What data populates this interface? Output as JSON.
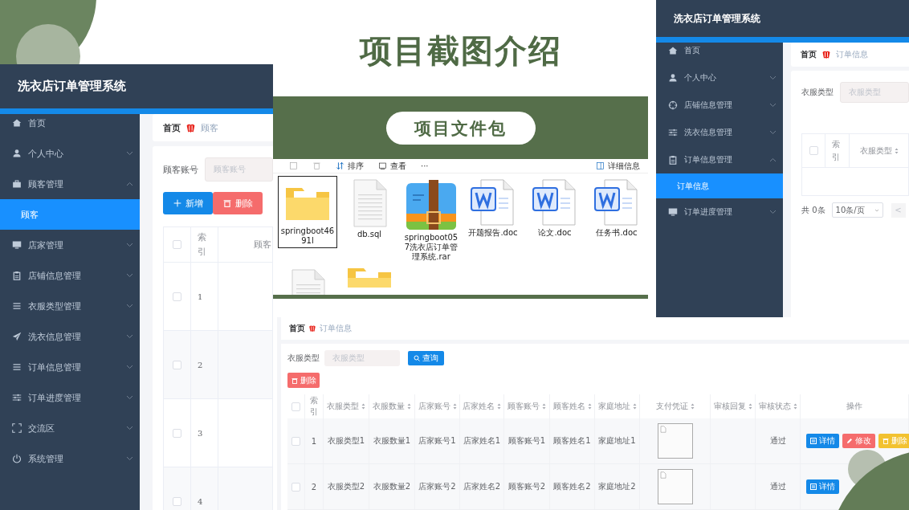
{
  "heading": "项目截图介绍",
  "customer_window": {
    "app_title": "洗衣店订单管理系统",
    "menu": [
      {
        "label": "首页"
      },
      {
        "label": "个人中心",
        "expanded": false
      },
      {
        "label": "顾客管理",
        "expanded": true,
        "children": [
          {
            "label": "顾客",
            "selected": true
          }
        ]
      },
      {
        "label": "店家管理",
        "expanded": false
      },
      {
        "label": "店铺信息管理",
        "expanded": false
      },
      {
        "label": "衣服类型管理",
        "expanded": false
      },
      {
        "label": "洗衣信息管理",
        "expanded": false
      },
      {
        "label": "订单信息管理",
        "expanded": false
      },
      {
        "label": "订单进度管理",
        "expanded": false
      },
      {
        "label": "交流区",
        "expanded": false
      },
      {
        "label": "系统管理",
        "expanded": false
      }
    ],
    "breadcrumb": [
      "首页",
      "顾客"
    ],
    "search": {
      "label": "顾客账号",
      "placeholder": "顾客账号"
    },
    "buttons": [
      {
        "kind": "add",
        "label": "新增"
      },
      {
        "kind": "delete",
        "label": "删除"
      }
    ],
    "table": {
      "all_checked": false,
      "columns": [
        "索引",
        "顾客"
      ],
      "rows": [
        {
          "index": "1",
          "checked": false
        },
        {
          "index": "2",
          "checked": false
        },
        {
          "index": "3",
          "checked": false
        },
        {
          "index": "4",
          "checked": false
        }
      ]
    }
  },
  "file_package": {
    "label": "项目文件包",
    "toolbar": {
      "sort": "排序",
      "view": "查看",
      "more": "···",
      "details": "详细信息"
    },
    "files": [
      {
        "kind": "folder",
        "name": "springboot4691l",
        "selected": true
      },
      {
        "kind": "text",
        "name": "db.sql",
        "selected": false
      },
      {
        "kind": "zip",
        "name": "springboot057洗衣店订单管理系统.rar",
        "selected": false
      },
      {
        "kind": "word",
        "name": "开题报告.doc",
        "selected": false
      },
      {
        "kind": "word",
        "name": "论文.doc",
        "selected": false
      },
      {
        "kind": "word",
        "name": "任务书.doc",
        "selected": false
      },
      {
        "kind": "text",
        "selected": false
      },
      {
        "kind": "folder",
        "selected": false
      }
    ]
  },
  "order_window": {
    "app_title": "洗衣店订单管理系统",
    "menu": [
      {
        "label": "首页"
      },
      {
        "label": "个人中心",
        "expanded": false
      },
      {
        "label": "店铺信息管理",
        "expanded": false
      },
      {
        "label": "洗衣信息管理",
        "expanded": false
      },
      {
        "label": "订单信息管理",
        "expanded": true,
        "children": [
          {
            "label": "订单信息",
            "selected": true
          }
        ]
      },
      {
        "label": "订单进度管理",
        "expanded": false
      }
    ],
    "breadcrumb": [
      "首页",
      "订单信息"
    ],
    "search": {
      "label": "衣服类型",
      "placeholder": "衣服类型"
    },
    "table": {
      "all_checked": false,
      "columns": [
        "索引",
        "衣服类型"
      ]
    },
    "pagination": {
      "total": "共 0条",
      "page_size": "10条/页",
      "prev": "<"
    }
  },
  "order_table_window": {
    "breadcrumb": [
      "首页",
      "订单信息"
    ],
    "search": {
      "label": "衣服类型",
      "placeholder": "衣服类型",
      "button": "查询"
    },
    "delete_button": "删除",
    "all_checked": false,
    "columns": [
      {
        "label": "索引",
        "sortable": false
      },
      {
        "label": "衣服类型",
        "sortable": true
      },
      {
        "label": "衣服数量",
        "sortable": true
      },
      {
        "label": "店家账号",
        "sortable": true
      },
      {
        "label": "店家姓名",
        "sortable": true
      },
      {
        "label": "顾客账号",
        "sortable": true
      },
      {
        "label": "顾客姓名",
        "sortable": true
      },
      {
        "label": "家庭地址",
        "sortable": true
      },
      {
        "label": "支付凭证",
        "sortable": true
      },
      {
        "label": "审核回复",
        "sortable": true
      },
      {
        "label": "审核状态",
        "sortable": true
      },
      {
        "label": "操作",
        "sortable": false
      }
    ],
    "rows": [
      {
        "checked": false,
        "cells": [
          "1",
          "衣服类型1",
          "衣服数量1",
          "店家账号1",
          "店家姓名1",
          "顾客账号1",
          "顾客姓名1",
          "家庭地址1"
        ],
        "status": "通过",
        "actions": [
          {
            "kind": "detail",
            "label": "详情"
          },
          {
            "kind": "edit",
            "label": "修改"
          },
          {
            "kind": "delete",
            "label": "删除"
          }
        ]
      },
      {
        "checked": false,
        "cells": [
          "2",
          "衣服类型2",
          "衣服数量2",
          "店家账号2",
          "店家姓名2",
          "顾客账号2",
          "顾客姓名2",
          "家庭地址2"
        ],
        "status": "通过",
        "actions": [
          {
            "kind": "detail",
            "label": "详情"
          }
        ]
      }
    ]
  }
}
